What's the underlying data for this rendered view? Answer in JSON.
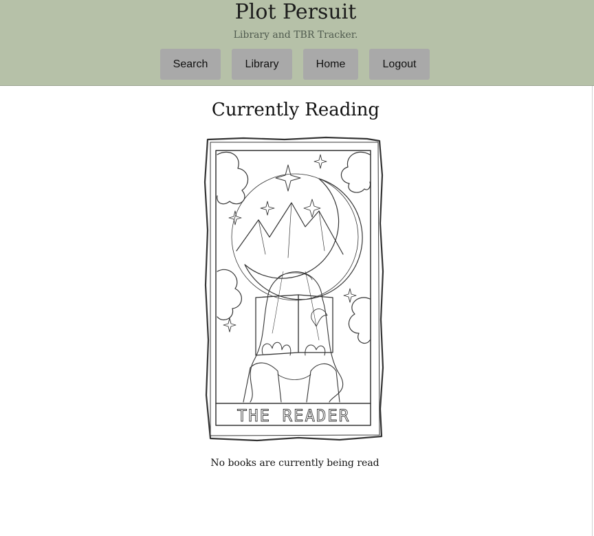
{
  "header": {
    "title": "Plot Persuit",
    "subtitle": "Library and TBR Tracker.",
    "bg_color": "#b6c1a8"
  },
  "nav": {
    "items": [
      {
        "label": "Search"
      },
      {
        "label": "Library"
      },
      {
        "label": "Home"
      },
      {
        "label": "Logout"
      }
    ],
    "button_color": "#a9a9a9"
  },
  "main": {
    "section_title": "Currently Reading",
    "card_caption": "THE READER",
    "empty_message": "No books are currently being read"
  }
}
